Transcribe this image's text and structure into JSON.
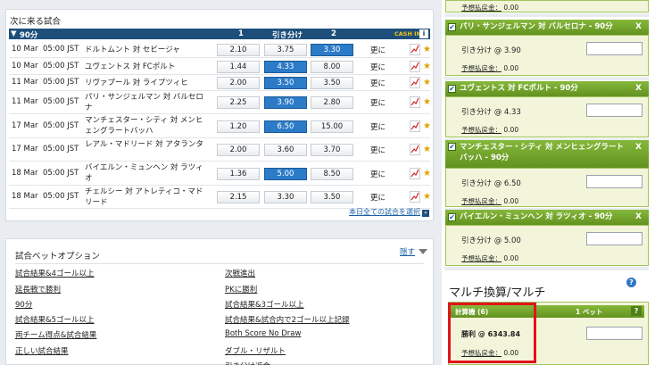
{
  "matches_panel": {
    "title": "次に来る試合",
    "section": "90分",
    "col1": "1",
    "colx": "引き分け",
    "col2": "2",
    "cashin": "CASH IN",
    "info_icon": "i",
    "more_label": "更に",
    "footer_link": "本日全ての試合を選択",
    "footer_arrow": "»",
    "rows": [
      {
        "date": "10 Mar",
        "time": "05:00 JST",
        "match": "ドルトムント 対 セビージャ",
        "o1": "2.10",
        "ox": "3.75",
        "o2": "3.30",
        "selected": "2"
      },
      {
        "date": "10 Mar",
        "time": "05:00 JST",
        "match": "ユヴェントス 対 FCポルト",
        "o1": "1.44",
        "ox": "4.33",
        "o2": "8.00",
        "selected": "x"
      },
      {
        "date": "11 Mar",
        "time": "05:00 JST",
        "match": "リヴァプール 対 ライプツィヒ",
        "o1": "2.00",
        "ox": "3.50",
        "o2": "3.50",
        "selected": "x"
      },
      {
        "date": "11 Mar",
        "time": "05:00 JST",
        "match": "パリ・サンジェルマン 対 バルセロナ",
        "o1": "2.25",
        "ox": "3.90",
        "o2": "2.80",
        "selected": "x"
      },
      {
        "date": "17 Mar",
        "time": "05:00 JST",
        "match": "マンチェスター・シティ 対 メンヒェングラートバッハ",
        "o1": "1.20",
        "ox": "6.50",
        "o2": "15.00",
        "selected": "x"
      },
      {
        "date": "17 Mar",
        "time": "05:00 JST",
        "match": "レアル・マドリード 対 アタランタ",
        "o1": "2.00",
        "ox": "3.60",
        "o2": "3.70",
        "selected": ""
      },
      {
        "date": "18 Mar",
        "time": "05:00 JST",
        "match": "バイエルン・ミュンヘン 対 ラツィオ",
        "o1": "1.36",
        "ox": "5.00",
        "o2": "8.50",
        "selected": "x"
      },
      {
        "date": "18 Mar",
        "time": "05:00 JST",
        "match": "チェルシー 対 アトレティコ・マドリード",
        "o1": "2.15",
        "ox": "3.30",
        "o2": "3.50",
        "selected": ""
      }
    ]
  },
  "options_panel": {
    "title": "試合ベットオプション",
    "hide_label": "隠す",
    "left_links": [
      "試合結果&4ゴール以上",
      "延長戦で勝利",
      "90分",
      "試合結果&5ゴール以上",
      "両チーム得点&試合結果",
      "正しい試合結果"
    ],
    "right_links": [
      "次戦進出",
      "PKに勝利",
      "試合結果&3ゴール以上",
      "試合結果&試合内で2ゴール以上記録",
      "Both Score No Draw",
      "ダブル・リザルト",
      "引き分け返金"
    ]
  },
  "betslip": {
    "top_payout_label": "予想払戻金：",
    "top_payout_value": "0.00",
    "bets": [
      {
        "selection": "パリ・サンジェルマン 対 バルセロナ - 90分",
        "pick": "引き分け @ 3.90",
        "payout_label": "予想払戻金：",
        "payout": "0.00"
      },
      {
        "selection": "ユヴェントス 対 FCポルト - 90分",
        "pick": "引き分け @ 4.33",
        "payout_label": "予想払戻金：",
        "payout": "0.00"
      },
      {
        "selection": "マンチェスター・シティ 対 メンヒェングラートバッハ - 90分",
        "pick": "引き分け @ 6.50",
        "payout_label": "予想払戻金：",
        "payout": "0.00"
      },
      {
        "selection": "バイエルン・ミュンヘン 対 ラツィオ - 90分",
        "pick": "引き分け @ 5.00",
        "payout_label": "予想払戻金：",
        "payout": "0.00"
      }
    ],
    "check_glyph": "✔",
    "close_glyph": "X",
    "multi_title": "マルチ換算/マルチ",
    "help_glyph": "?",
    "calc": {
      "label": "計算機 (6)",
      "bet_count": "1 ベット",
      "help": "?",
      "win": "勝利 @ 6343.84",
      "payout_label": "予想払戻金：",
      "payout": "0.00"
    }
  },
  "colors": {
    "accent_green": "#6fa12a",
    "accent_blue": "#2c7bc8",
    "header_navy": "#1d4f7a",
    "highlight_red": "#e0141c"
  }
}
